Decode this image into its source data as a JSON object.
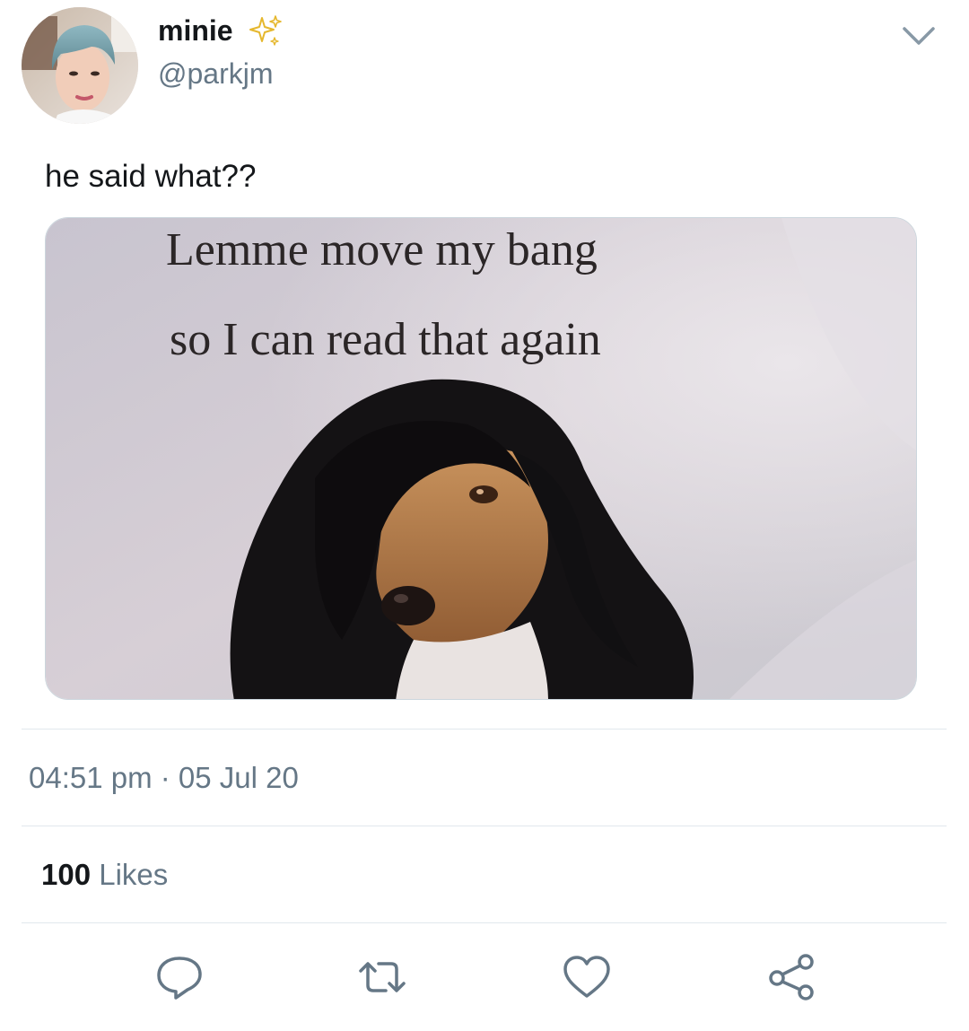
{
  "author": {
    "display_name": "minie",
    "handle": "@parkjm",
    "badge_icon": "sparkles-icon",
    "avatar": "avatar"
  },
  "tweet": {
    "text": "he said what??",
    "timestamp": "04:51 pm · 05 Jul 20",
    "likes_count": "100",
    "likes_label": "Likes"
  },
  "media": {
    "caption_line1": "Lemme move my bang",
    "caption_line2": "so I can read that again"
  },
  "actions": [
    {
      "name": "reply",
      "icon": "reply-icon"
    },
    {
      "name": "retweet",
      "icon": "retweet-icon"
    },
    {
      "name": "like",
      "icon": "heart-icon"
    },
    {
      "name": "share",
      "icon": "share-icon"
    }
  ],
  "colors": {
    "text_primary": "#14171a",
    "text_secondary": "#657786",
    "divider": "#e1e8ed",
    "sparkle": "#f5c542",
    "icon_gray": "#657786"
  }
}
